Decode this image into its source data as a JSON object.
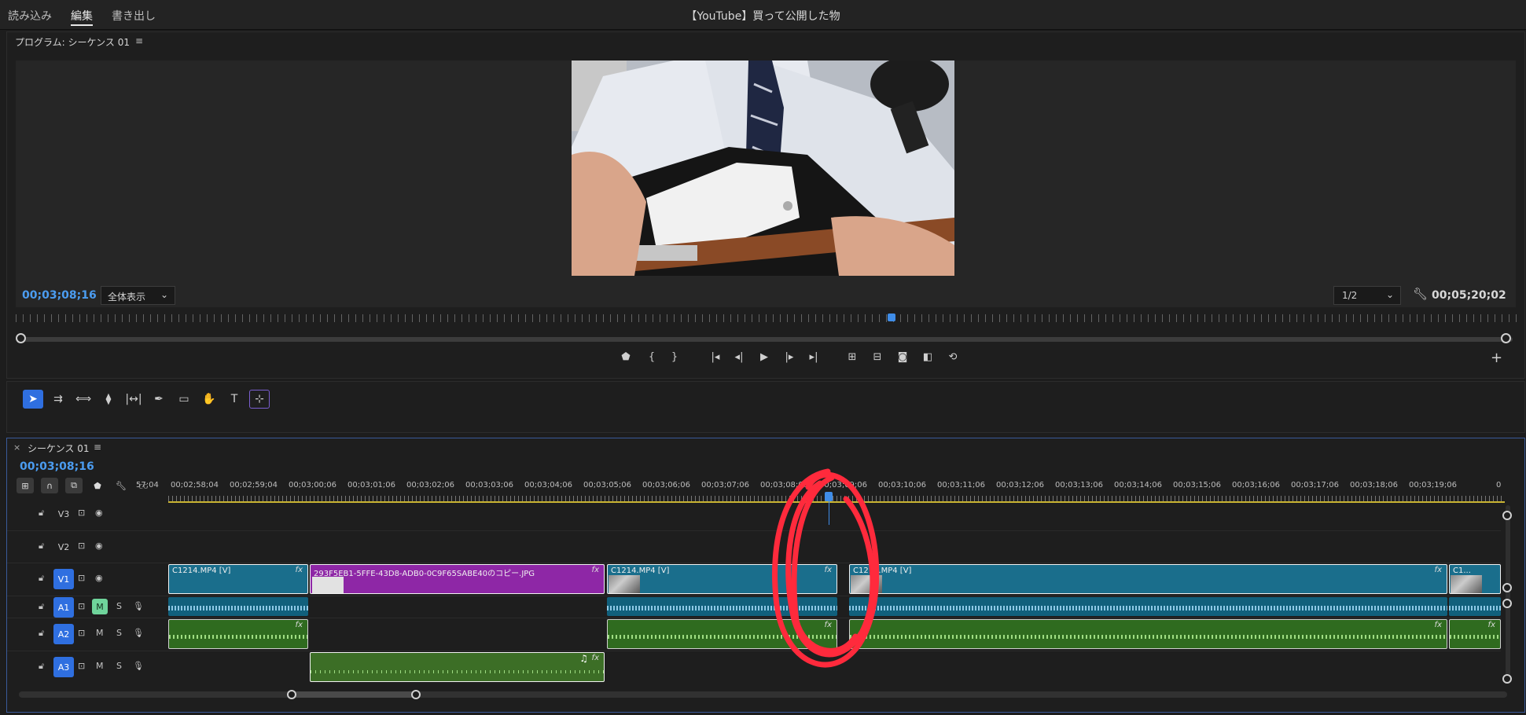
{
  "topbar": {
    "workspaces": [
      "読み込み",
      "編集",
      "書き出し"
    ],
    "active_workspace": "編集",
    "document_title": "【YouTube】買って公開した物"
  },
  "program_monitor": {
    "title": "プログラム: シーケンス 01",
    "menu_icon": "≡",
    "current_timecode": "00;03;08;16",
    "fit_label": "全体表示",
    "resolution_label": "1/2",
    "duration_timecode": "00;05;20;02"
  },
  "timeline": {
    "close": "×",
    "title": "シーケンス 01",
    "menu_icon": "≡",
    "current_timecode": "00;03;08;16",
    "ruler_labels": [
      "57;04",
      "00;02;58;04",
      "00;02;59;04",
      "00;03;00;06",
      "00;03;01;06",
      "00;03;02;06",
      "00;03;03;06",
      "00;03;04;06",
      "00;03;05;06",
      "00;03;06;06",
      "00;03;07;06",
      "00;03;08;06",
      "00;03;09;06",
      "00;03;10;06",
      "00;03;11;06",
      "00;03;12;06",
      "00;03;13;06",
      "00;03;14;06",
      "00;03;15;06",
      "00;03;16;06",
      "00;03;17;06",
      "00;03;18;06",
      "00;03;19;06",
      "0"
    ],
    "tracks": {
      "v3": "V3",
      "v2": "V2",
      "v1": "V1",
      "a1": "A1",
      "a2": "A2",
      "a3": "A3",
      "m": "M",
      "s": "S"
    },
    "clips": {
      "v1_clip1": "C1214.MP4 [V]",
      "v1_img": "293F5EB1-5FFE-43D8-ADB0-0C9F65SABE40のコピー.JPG",
      "v1_clip2": "C1214.MP4 [V]",
      "v1_clip3": "C1214.MP4 [V]",
      "v1_clip4": "C1...",
      "fx": "fx"
    }
  },
  "colors": {
    "accent_blue": "#4b9cf0",
    "video_clip": "#1a6e8c",
    "image_clip": "#8e27a6",
    "audio_a2": "#2f6b1f",
    "annotation_red": "#ff2a3c"
  }
}
